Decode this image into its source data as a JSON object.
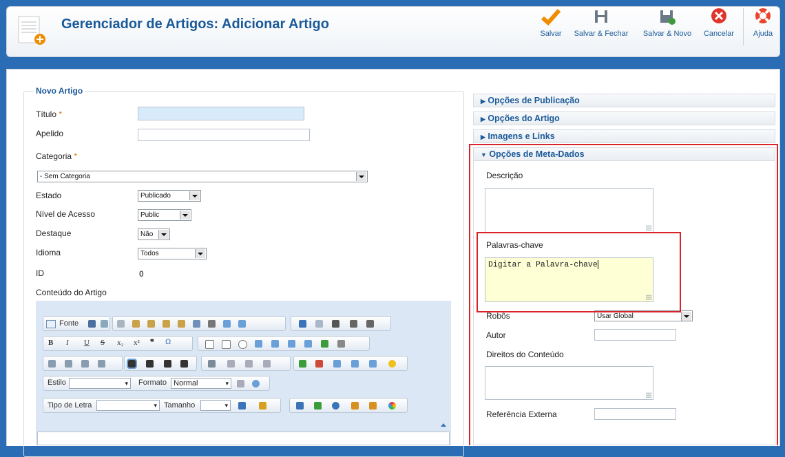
{
  "header": {
    "title": "Gerenciador de Artigos: Adicionar Artigo",
    "toolbar": {
      "save": "Salvar",
      "save_close": "Salvar & Fechar",
      "save_new": "Salvar & Novo",
      "cancel": "Cancelar",
      "help": "Ajuda"
    }
  },
  "form": {
    "legend": "Novo Artigo",
    "title_label": "Título",
    "required_mark": "*",
    "alias_label": "Apelido",
    "category_label": "Categoria",
    "category_value": "- Sem Categoria",
    "state_label": "Estado",
    "state_value": "Publicado",
    "access_label": "Nível de Acesso",
    "access_value": "Public",
    "featured_label": "Destaque",
    "featured_value": "Não",
    "language_label": "Idioma",
    "language_value": "Todos",
    "id_label": "ID",
    "id_value": "0",
    "content_label": "Conteúdo do Artigo"
  },
  "editor": {
    "source_label": "Fonte",
    "style_label": "Estilo",
    "format_label": "Formato",
    "format_value": "Normal",
    "font_label": "Tipo de Letra",
    "size_label": "Tamanho"
  },
  "panels": {
    "publishing": "Opções de Publicação",
    "article": "Opções do Artigo",
    "images": "Imagens e Links",
    "metadata": "Opções de Meta-Dados"
  },
  "metadata": {
    "description_label": "Descrição",
    "keywords_label": "Palavras-chave",
    "keywords_value": "Digitar a Palavra-chave",
    "robots_label": "Robôs",
    "robots_value": "Usar Global",
    "author_label": "Autor",
    "rights_label": "Direitos do Conteúdo",
    "xref_label": "Referência Externa"
  },
  "colors": {
    "accent": "#1b5a99",
    "highlight": "#d9232a",
    "background": "#2a6db5"
  }
}
